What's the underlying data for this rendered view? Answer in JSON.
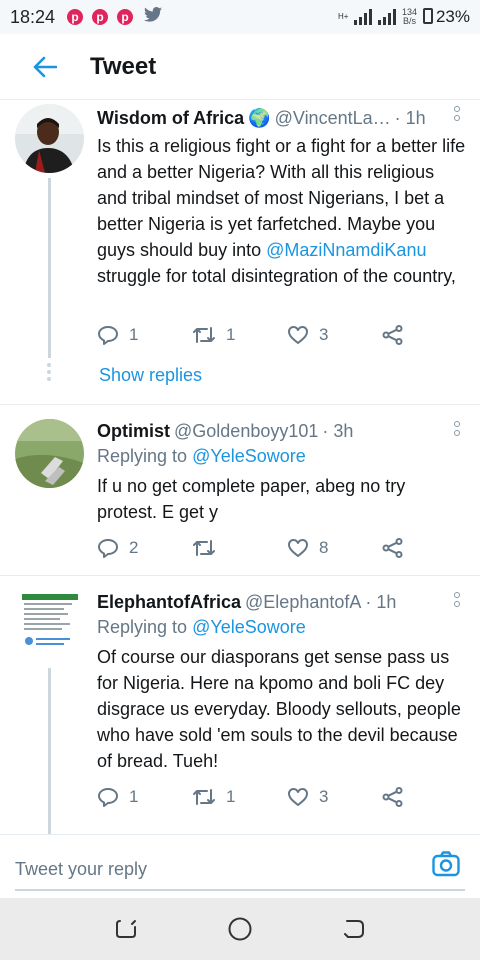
{
  "status_bar": {
    "time": "18:24",
    "notification_icons": [
      "p",
      "p",
      "p"
    ],
    "net_speed_value": "134",
    "net_speed_unit": "B/s",
    "network_type": "H+",
    "battery": "23%"
  },
  "header": {
    "title": "Tweet"
  },
  "tweets": [
    {
      "name": "Wisdom of Africa",
      "name_emoji": "🌍",
      "handle": "@VincentLa…",
      "time": "· 1h",
      "body_pre": "Is this a religious fight or a fight for a better life and a better Nigeria? With all this religious and tribal mindset of most Nigerians, I bet a better Nigeria is yet farfetched. Maybe you guys should buy into ",
      "body_mention": "@MaziNnamdiKanu",
      "body_post": " struggle for total disintegration of the country,",
      "replies": "1",
      "retweets": "1",
      "likes": "3",
      "show_replies": "Show replies"
    },
    {
      "name": "Optimist",
      "handle": "@Goldenboyy101",
      "time": "· 3h",
      "replying_to_label": "Replying to",
      "replying_to_handle": "@YeleSowore",
      "body": "If u no get complete paper, abeg no try protest. E get y",
      "replies": "2",
      "retweets": "",
      "likes": "8"
    },
    {
      "name": "ElephantofAfrica",
      "handle": "@ElephantofA",
      "time": "· 1h",
      "replying_to_label": "Replying to",
      "replying_to_handle": "@YeleSowore",
      "body": "Of course our diasporans get sense pass us for Nigeria. Here na kpomo and boli FC dey disgrace us everyday. Bloody sellouts, people who have sold 'em souls to the devil because of bread. Tueh!",
      "replies": "1",
      "retweets": "1",
      "likes": "3"
    }
  ],
  "reply_bar": {
    "placeholder": "Tweet your reply"
  },
  "colors": {
    "accent": "#1b95e0",
    "text": "#14171a",
    "secondary": "#657786",
    "divider": "#e6ecf0"
  }
}
